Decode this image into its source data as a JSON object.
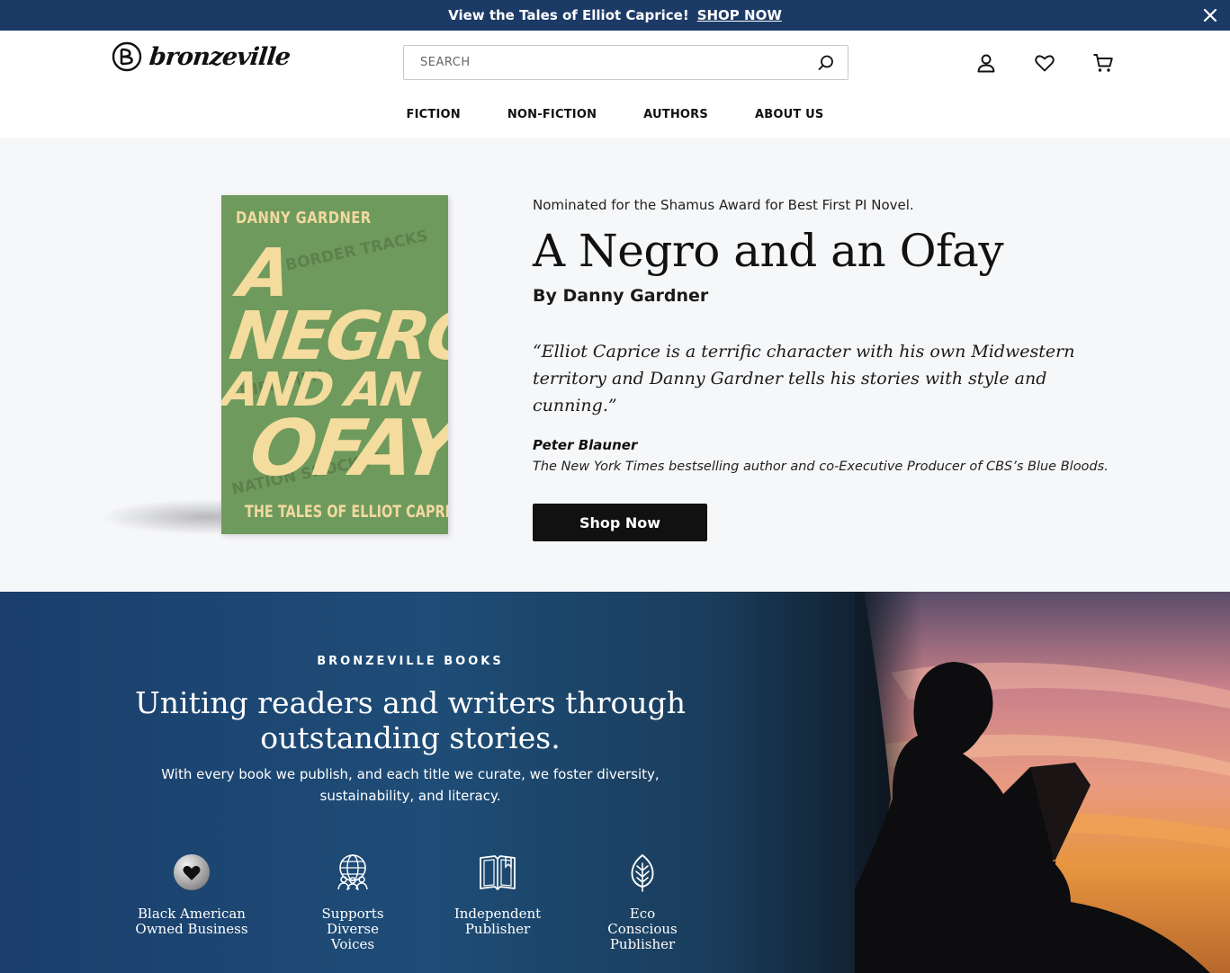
{
  "announcement": {
    "message": "View the Tales of Elliot Caprice!",
    "cta": "SHOP NOW"
  },
  "header": {
    "logo_text": "bronzeville",
    "search": {
      "placeholder": "SEARCH"
    },
    "icons": [
      "account-icon",
      "wishlist-heart-icon",
      "cart-icon",
      "search-icon",
      "close-icon"
    ]
  },
  "nav": {
    "items": [
      "FICTION",
      "NON-FICTION",
      "AUTHORS",
      "ABOUT US"
    ]
  },
  "hero": {
    "tagline": "Nominated for the Shamus Award for Best First PI Novel.",
    "title": "A Negro and an Ofay",
    "byline": "By Danny Gardner",
    "quote": "“Elliot Caprice is a terrific character with his own Midwestern territory and Danny Gardner tells his stories with style and cunning.”",
    "quote_author": "Peter Blauner",
    "quote_role": "The New York Times bestselling author and co-Executive Producer of CBS’s Blue Bloods.",
    "cta": "Shop Now",
    "cover": {
      "author": "DANNY GARDNER",
      "title_line1": "A NEGRO",
      "title_line2": "AND AN",
      "title_line3": "OFAY",
      "subtitle": "THE TALES OF ELLIOT CAPRICE"
    }
  },
  "mission": {
    "eyebrow": "BRONZEVILLE BOOKS",
    "headline_line1": "Uniting readers and writers through",
    "headline_line2": "outstanding stories.",
    "subtext": "With every book we publish, and each title we curate, we foster diversity, sustainability, and literacy.",
    "values": [
      {
        "icon": "heart-badge-icon",
        "label_lines": [
          "Black American",
          "Owned Business"
        ]
      },
      {
        "icon": "globe-people-icon",
        "label_lines": [
          "Supports",
          "Diverse",
          "Voices"
        ]
      },
      {
        "icon": "open-book-icon",
        "label_lines": [
          "Independent",
          "Publisher"
        ]
      },
      {
        "icon": "leaf-icon",
        "label_lines": [
          "Eco",
          "Conscious",
          "Publisher"
        ]
      }
    ]
  },
  "colors": {
    "announcement_bg": "#1c3a66",
    "button_bg": "#111111",
    "cover_green": "#6f9a5d",
    "cover_text": "#f3dc9d"
  }
}
